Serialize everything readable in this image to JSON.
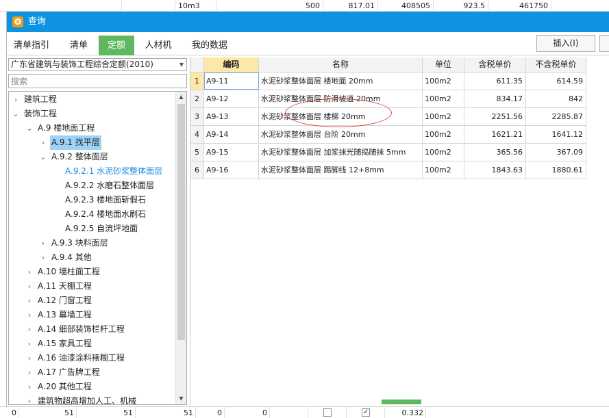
{
  "background": {
    "top_row": [
      "10m3",
      "500",
      "817.01",
      "408505",
      "923.5",
      "461750"
    ],
    "bottom_row": [
      "0",
      "51",
      "51",
      "51",
      "0",
      "0",
      "0.332"
    ]
  },
  "dialog": {
    "title": "查询",
    "tabs": [
      {
        "label": "清单指引"
      },
      {
        "label": "清单"
      },
      {
        "label": "定额"
      },
      {
        "label": "人材机"
      },
      {
        "label": "我的数据"
      }
    ],
    "insert_button": "插入(I)"
  },
  "left": {
    "dropdown_value": "广东省建筑与装饰工程综合定额(2010)",
    "search_placeholder": "搜索",
    "tree": [
      {
        "label": "建筑工程",
        "chevron": "›",
        "depth": 0
      },
      {
        "label": "装饰工程",
        "chevron": "⌄",
        "depth": 0
      },
      {
        "label": "A.9 楼地面工程",
        "chevron": "⌄",
        "depth": 1
      },
      {
        "label": "A.9.1 找平层",
        "chevron": "›",
        "depth": 2,
        "selected": true
      },
      {
        "label": "A.9.2 整体面层",
        "chevron": "⌄",
        "depth": 2
      },
      {
        "label": "A.9.2.1 水泥砂浆整体面层",
        "chevron": "",
        "depth": 3,
        "current": true
      },
      {
        "label": "A.9.2.2 水磨石整体面层",
        "chevron": "",
        "depth": 3
      },
      {
        "label": "A.9.2.3 楼地面斩假石",
        "chevron": "",
        "depth": 3
      },
      {
        "label": "A.9.2.4 楼地面水刷石",
        "chevron": "",
        "depth": 3
      },
      {
        "label": "A.9.2.5 自流坪地面",
        "chevron": "",
        "depth": 3
      },
      {
        "label": "A.9.3 块料面层",
        "chevron": "›",
        "depth": 2
      },
      {
        "label": "A.9.4 其他",
        "chevron": "›",
        "depth": 2
      },
      {
        "label": "A.10 墙柱面工程",
        "chevron": "›",
        "depth": 1
      },
      {
        "label": "A.11 天棚工程",
        "chevron": "›",
        "depth": 1
      },
      {
        "label": "A.12 门窗工程",
        "chevron": "›",
        "depth": 1
      },
      {
        "label": "A.13 幕墙工程",
        "chevron": "›",
        "depth": 1
      },
      {
        "label": "A.14 细部装饰栏杆工程",
        "chevron": "›",
        "depth": 1
      },
      {
        "label": "A.15 家具工程",
        "chevron": "›",
        "depth": 1
      },
      {
        "label": "A.16 油漆涂料裱糊工程",
        "chevron": "›",
        "depth": 1
      },
      {
        "label": "A.17 广告牌工程",
        "chevron": "›",
        "depth": 1
      },
      {
        "label": "A.20 其他工程",
        "chevron": "›",
        "depth": 1
      },
      {
        "label": "建筑物超高增加人工、机械",
        "chevron": "›",
        "depth": 1
      }
    ]
  },
  "grid": {
    "headers": [
      "编码",
      "名称",
      "单位",
      "含税单价",
      "不含税单价"
    ],
    "rows": [
      {
        "num": "1",
        "code": "A9-11",
        "name": "水泥砂浆整体面层 楼地面 20mm",
        "unit": "100m2",
        "price_tax": "611.35",
        "price_notax": "614.59"
      },
      {
        "num": "2",
        "code": "A9-12",
        "name": "水泥砂浆整体面层 防滑坡道 20mm",
        "unit": "100m2",
        "price_tax": "834.17",
        "price_notax": "842"
      },
      {
        "num": "3",
        "code": "A9-13",
        "name": "水泥砂浆整体面层 楼梯 20mm",
        "unit": "100m2",
        "price_tax": "2251.56",
        "price_notax": "2285.87"
      },
      {
        "num": "4",
        "code": "A9-14",
        "name": "水泥砂浆整体面层 台阶 20mm",
        "unit": "100m2",
        "price_tax": "1621.21",
        "price_notax": "1641.12"
      },
      {
        "num": "5",
        "code": "A9-15",
        "name": "水泥砂浆整体面层 加浆抹光随捣随抹 5mm",
        "unit": "100m2",
        "price_tax": "365.56",
        "price_notax": "367.09"
      },
      {
        "num": "6",
        "code": "A9-16",
        "name": "水泥砂浆整体面层 踢脚线 12+8mm",
        "unit": "100m2",
        "price_tax": "1843.63",
        "price_notax": "1880.61"
      }
    ]
  }
}
